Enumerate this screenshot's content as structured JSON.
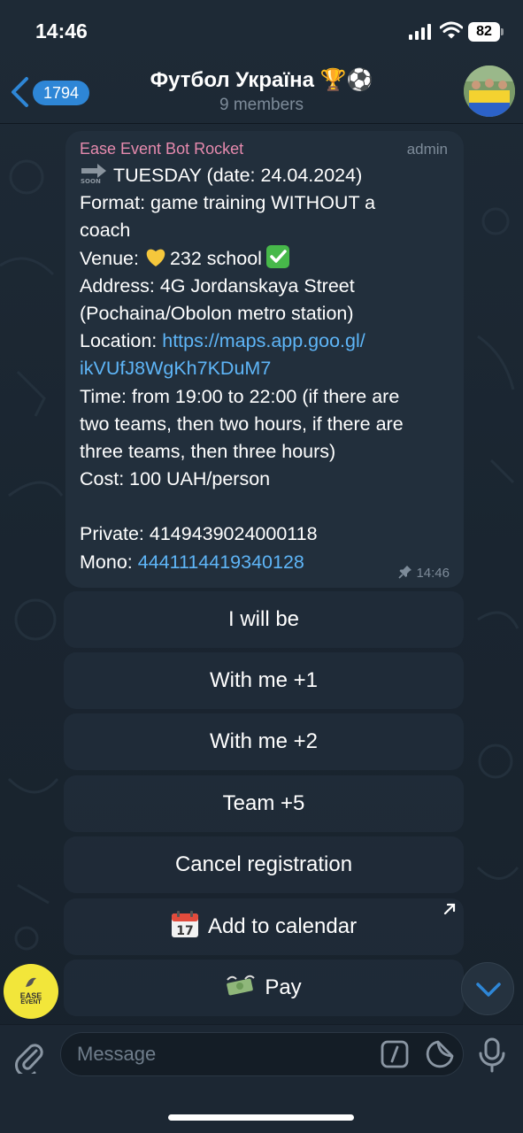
{
  "status_bar": {
    "time": "14:46",
    "battery": "82"
  },
  "header": {
    "back_count": "1794",
    "title": "Футбол Україна 🏆⚽",
    "subtitle": "9 members"
  },
  "message": {
    "sender": "Ease Event Bot Rocket",
    "role": "admin",
    "lines": {
      "l1": "TUESDAY (date: 24.04.2024)",
      "l2": "Format: game training WITHOUT a",
      "l3": "coach",
      "l4a": "Venue: ",
      "l4b": "232 school",
      "l5": "Address: 4G Jordanskaya Street",
      "l6": "(Pochaina/Obolon metro station)",
      "l7a": "Location: ",
      "l7b": "https://maps.app.goo.gl/",
      "l8": "ikVUfJ8WgKh7KDuM7",
      "l9": "Time: from 19:00 to 22:00 (if there are",
      "l10": "two teams, then two hours, if there are",
      "l11": "three teams, then three hours)",
      "l12": "Cost: 100 UAH/person",
      "l14": "Private: 4149439024000118",
      "l15a": "Mono: ",
      "l15b": "4441114419340128"
    },
    "time": "14:46"
  },
  "keyboard": {
    "b1": "I will be",
    "b2": "With me +1",
    "b3": "With me +2",
    "b4": "Team +5",
    "b5": "Cancel registration",
    "b6": "Add to calendar",
    "b7": "Pay"
  },
  "bot_avatar": {
    "line1": "EASE",
    "line2": "EVENT"
  },
  "composer": {
    "placeholder": "Message"
  },
  "colors": {
    "link": "#5eb5f7",
    "sender": "#e68aae",
    "accent": "#2e86d6",
    "bubble": "#222f3c"
  },
  "icons": [
    "back-chevron-icon",
    "soon-arrow-icon",
    "yellow-heart-icon",
    "check-mark-icon",
    "pin-icon",
    "calendar-icon",
    "money-icon",
    "external-arrow-icon",
    "chevron-down-icon",
    "paperclip-icon",
    "slash-commands-icon",
    "sticker-icon",
    "microphone-icon"
  ]
}
